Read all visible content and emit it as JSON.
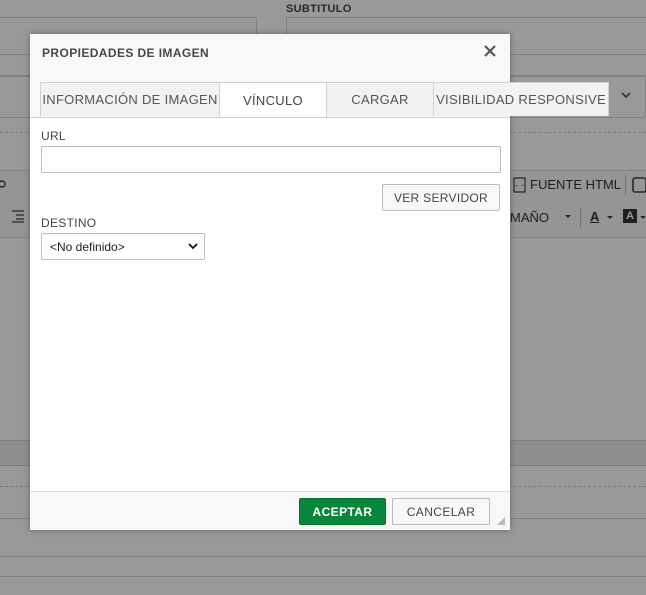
{
  "background": {
    "subtitle_label": "SUBTITULO",
    "toolbar_source_label": "FUENTE HTML",
    "toolbar_size_label": "MAÑO"
  },
  "dialog": {
    "title": "PROPIEDADES DE IMAGEN",
    "close_icon": "close-icon",
    "tabs": [
      {
        "label": "INFORMACIÓN DE IMAGEN",
        "active": false
      },
      {
        "label": "VÍNCULO",
        "active": true
      },
      {
        "label": "CARGAR",
        "active": false
      },
      {
        "label": "VISIBILIDAD RESPONSIVE",
        "active": false
      }
    ],
    "url": {
      "label": "URL",
      "value": ""
    },
    "browse_server_label": "VER SERVIDOR",
    "target": {
      "label": "DESTINO",
      "selected": "<No definido>"
    },
    "footer": {
      "ok_label": "ACEPTAR",
      "cancel_label": "CANCELAR"
    }
  },
  "colors": {
    "accept_green": "#09863e",
    "overlay": "rgba(0,0,0,0.40)"
  }
}
